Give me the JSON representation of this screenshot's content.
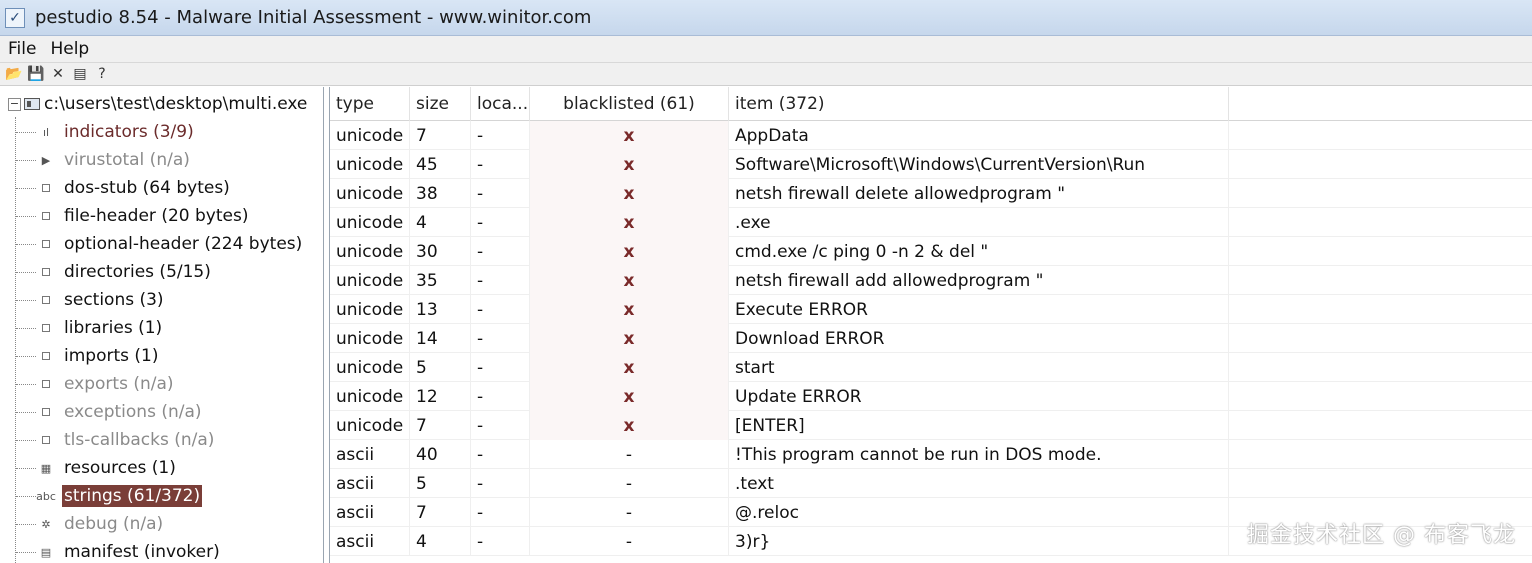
{
  "window": {
    "title": "pestudio 8.54 - Malware Initial Assessment - www.winitor.com"
  },
  "menu": [
    "File",
    "Help"
  ],
  "toolbar": {
    "buttons": [
      {
        "icon": "open-folder-icon",
        "glyph": "📂"
      },
      {
        "icon": "save-icon",
        "glyph": "💾"
      },
      {
        "icon": "close-icon",
        "glyph": "✕"
      },
      {
        "icon": "options-icon",
        "glyph": "▤"
      },
      {
        "icon": "help-icon",
        "glyph": "?"
      }
    ]
  },
  "tree": {
    "root": "c:\\users\\test\\desktop\\multi.exe",
    "items": [
      {
        "label": "indicators (3/9)",
        "icon": "indicators-icon",
        "glyph": "ıl",
        "style": "accent"
      },
      {
        "label": "virustotal (n/a)",
        "icon": "virustotal-icon",
        "glyph": "▶",
        "style": "dim"
      },
      {
        "label": "dos-stub (64 bytes)",
        "icon": "node-icon",
        "glyph": "sq",
        "style": "normal"
      },
      {
        "label": "file-header (20 bytes)",
        "icon": "node-icon",
        "glyph": "sq",
        "style": "normal"
      },
      {
        "label": "optional-header (224 bytes)",
        "icon": "node-icon",
        "glyph": "sq",
        "style": "normal"
      },
      {
        "label": "directories (5/15)",
        "icon": "node-icon",
        "glyph": "sq",
        "style": "normal"
      },
      {
        "label": "sections (3)",
        "icon": "node-icon",
        "glyph": "sq",
        "style": "normal"
      },
      {
        "label": "libraries (1)",
        "icon": "node-icon",
        "glyph": "sq",
        "style": "normal"
      },
      {
        "label": "imports (1)",
        "icon": "node-icon",
        "glyph": "sq",
        "style": "normal"
      },
      {
        "label": "exports (n/a)",
        "icon": "node-icon",
        "glyph": "sq",
        "style": "dim"
      },
      {
        "label": "exceptions (n/a)",
        "icon": "node-icon",
        "glyph": "sq",
        "style": "dim"
      },
      {
        "label": "tls-callbacks (n/a)",
        "icon": "node-icon",
        "glyph": "sq",
        "style": "dim"
      },
      {
        "label": "resources (1)",
        "icon": "resources-icon",
        "glyph": "▦",
        "style": "normal"
      },
      {
        "label": "strings (61/372)",
        "icon": "strings-icon",
        "glyph": "abc",
        "style": "selected"
      },
      {
        "label": "debug (n/a)",
        "icon": "debug-icon",
        "glyph": "✲",
        "style": "dim"
      },
      {
        "label": "manifest (invoker)",
        "icon": "manifest-icon",
        "glyph": "▤",
        "style": "normal"
      }
    ]
  },
  "table": {
    "columns": [
      "type",
      "size",
      "loca...",
      "blacklisted (61)",
      "item (372)"
    ],
    "rows": [
      {
        "type": "unicode",
        "size": "7",
        "loc": "-",
        "bl": "x",
        "item": "AppData"
      },
      {
        "type": "unicode",
        "size": "45",
        "loc": "-",
        "bl": "x",
        "item": "Software\\Microsoft\\Windows\\CurrentVersion\\Run"
      },
      {
        "type": "unicode",
        "size": "38",
        "loc": "-",
        "bl": "x",
        "item": "netsh firewall delete allowedprogram \""
      },
      {
        "type": "unicode",
        "size": "4",
        "loc": "-",
        "bl": "x",
        "item": ".exe"
      },
      {
        "type": "unicode",
        "size": "30",
        "loc": "-",
        "bl": "x",
        "item": "cmd.exe /c ping 0 -n 2 & del \""
      },
      {
        "type": "unicode",
        "size": "35",
        "loc": "-",
        "bl": "x",
        "item": "netsh firewall add allowedprogram \""
      },
      {
        "type": "unicode",
        "size": "13",
        "loc": "-",
        "bl": "x",
        "item": "Execute ERROR"
      },
      {
        "type": "unicode",
        "size": "14",
        "loc": "-",
        "bl": "x",
        "item": "Download ERROR"
      },
      {
        "type": "unicode",
        "size": "5",
        "loc": "-",
        "bl": "x",
        "item": "start"
      },
      {
        "type": "unicode",
        "size": "12",
        "loc": "-",
        "bl": "x",
        "item": "Update ERROR"
      },
      {
        "type": "unicode",
        "size": "7",
        "loc": "-",
        "bl": "x",
        "item": "[ENTER]"
      },
      {
        "type": "ascii",
        "size": "40",
        "loc": "-",
        "bl": "-",
        "item": "!This program cannot be run in DOS mode."
      },
      {
        "type": "ascii",
        "size": "5",
        "loc": "-",
        "bl": "-",
        "item": ".text"
      },
      {
        "type": "ascii",
        "size": "7",
        "loc": "-",
        "bl": "-",
        "item": "@.reloc"
      },
      {
        "type": "ascii",
        "size": "4",
        "loc": "-",
        "bl": "-",
        "item": "3)r}"
      }
    ]
  },
  "watermark": "掘金技术社区 @ 布客飞龙"
}
